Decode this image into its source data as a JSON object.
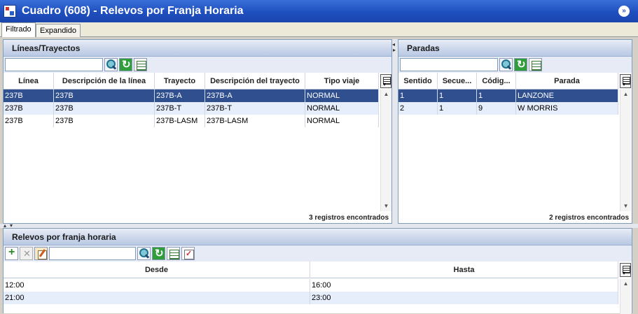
{
  "window": {
    "title": "Cuadro (608) - Relevos por Franja Horaria",
    "collapse_glyph": "»"
  },
  "tabs": [
    {
      "label": "Filtrado",
      "active": true
    },
    {
      "label": "Expandido",
      "active": false
    }
  ],
  "lineas": {
    "title": "Líneas/Trayectos",
    "search": {
      "value": "",
      "placeholder": ""
    },
    "columns": [
      "Línea",
      "Descripción de la línea",
      "Trayecto",
      "Descripción del trayecto",
      "Tipo viaje"
    ],
    "rows": [
      [
        "237B",
        "237B",
        "237B-A",
        "237B-A",
        "NORMAL"
      ],
      [
        "237B",
        "237B",
        "237B-T",
        "237B-T",
        "NORMAL"
      ],
      [
        "237B",
        "237B",
        "237B-LASM",
        "237B-LASM",
        "NORMAL"
      ]
    ],
    "selected_row": 0,
    "status": "3 registros encontrados"
  },
  "paradas": {
    "title": "Paradas",
    "search": {
      "value": "",
      "placeholder": ""
    },
    "columns": [
      "Sentido",
      "Secue...",
      "Códig...",
      "Parada"
    ],
    "rows": [
      [
        "1",
        "1",
        "1",
        "LANZONE"
      ],
      [
        "2",
        "1",
        "9",
        "W MORRIS"
      ]
    ],
    "selected_row": 0,
    "status": "2 registros encontrados"
  },
  "relevos": {
    "title": "Relevos por franja horaria",
    "search": {
      "value": "",
      "placeholder": ""
    },
    "columns": [
      "Desde",
      "Hasta"
    ],
    "rows": [
      [
        "12:00",
        "16:00"
      ],
      [
        "21:00",
        "23:00"
      ]
    ]
  },
  "glyphs": {
    "scroll_up": "▲",
    "scroll_down": "▼",
    "grip_left": "◂",
    "grip_right": "▸",
    "grip_up": "▴",
    "grip_down": "▾"
  },
  "colors": {
    "title_bar": "#1f4fbf",
    "selection": "#2f4f8f",
    "alt_row": "#e7eefb",
    "panel_header": "#c9d5ea"
  }
}
